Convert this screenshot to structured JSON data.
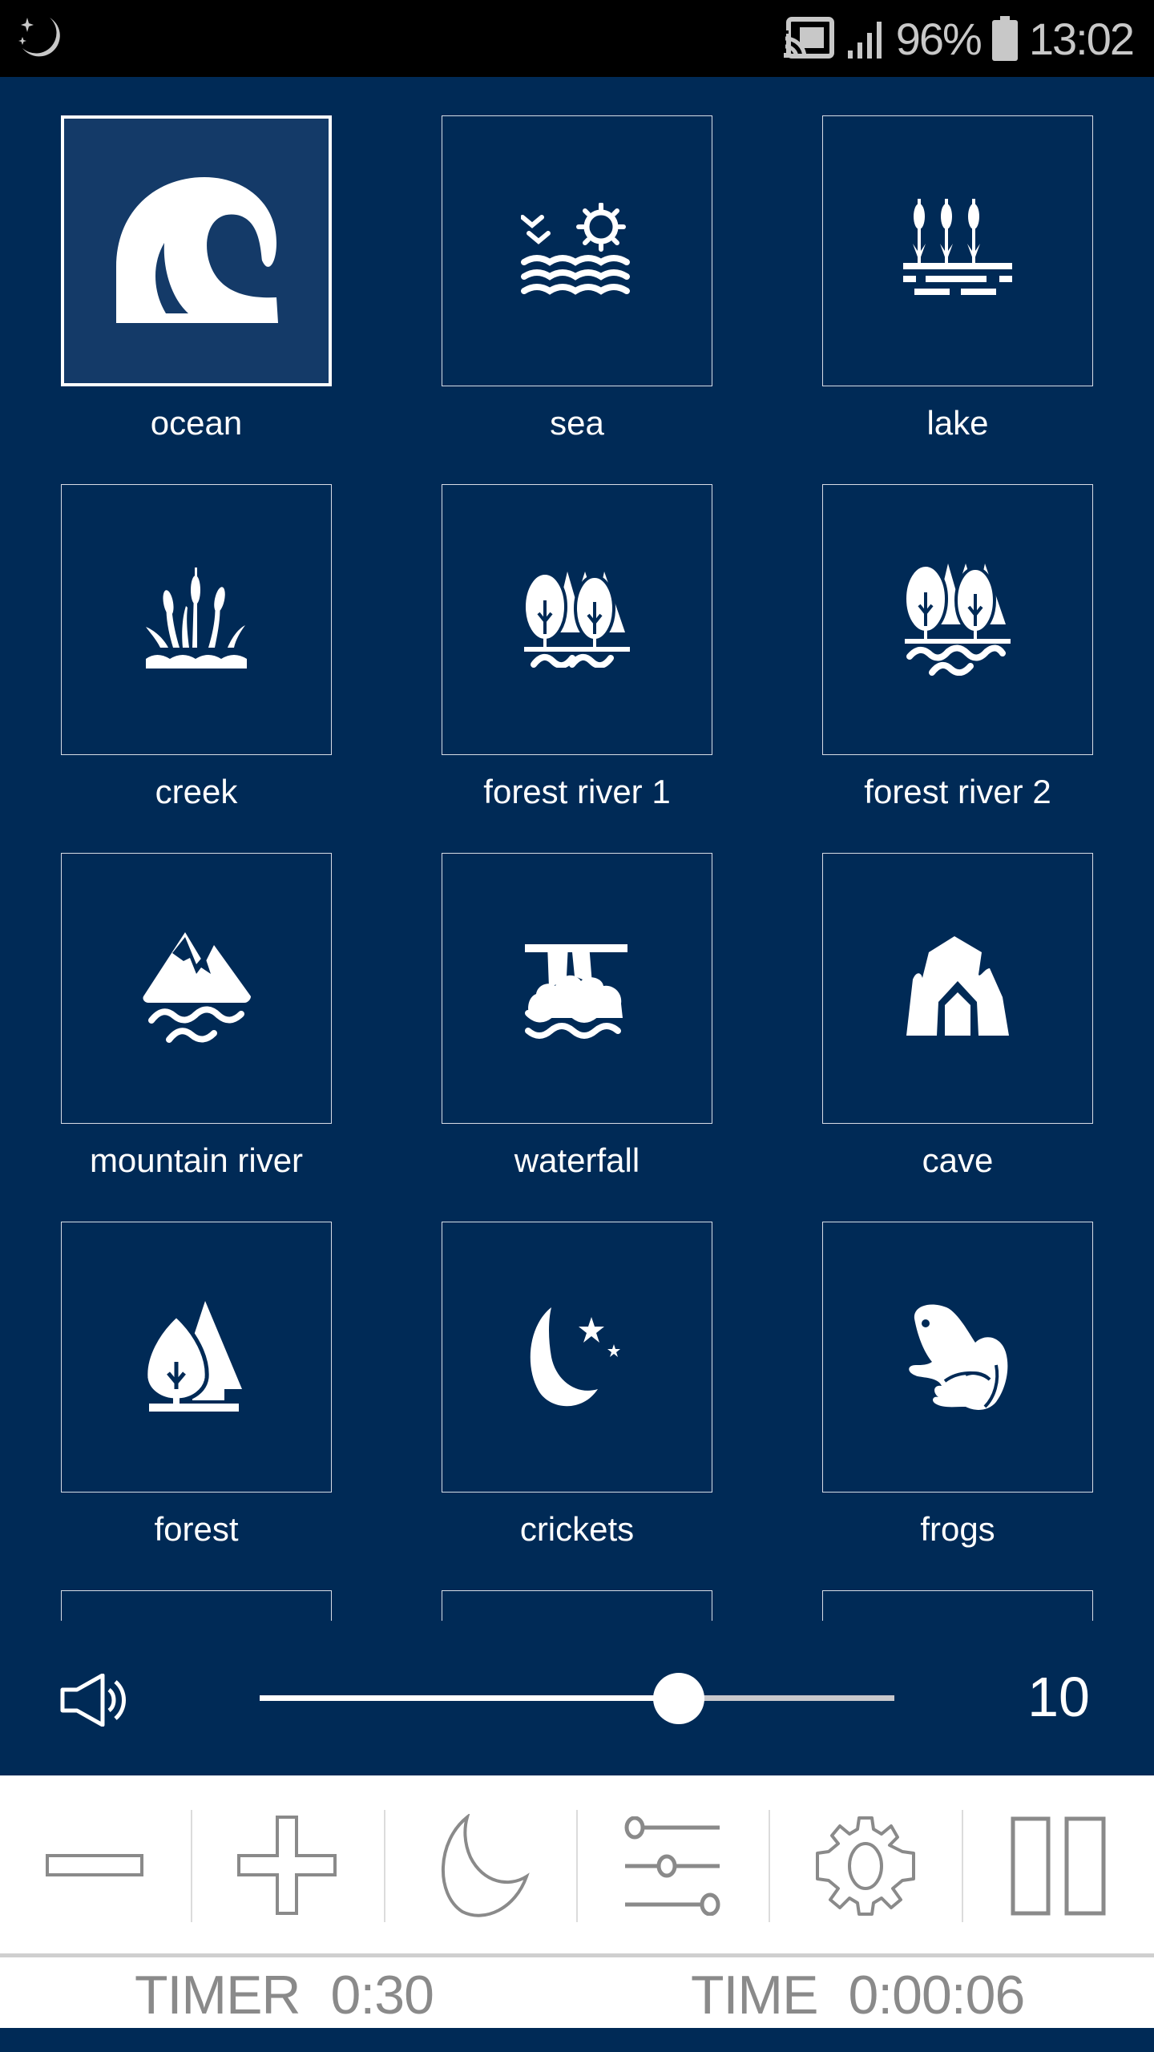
{
  "status_bar": {
    "left_icon": "night-mode-moon-icon",
    "cast_icon": "screen-cast-icon",
    "signal_icon": "signal-strength-icon",
    "battery_percent": "96%",
    "battery_icon": "battery-icon",
    "clock": "13:02"
  },
  "sounds": [
    {
      "label": "ocean",
      "icon": "wave-icon",
      "selected": true
    },
    {
      "label": "sea",
      "icon": "sea-birds-sun-icon",
      "selected": false
    },
    {
      "label": "lake",
      "icon": "cattails-lake-icon",
      "selected": false
    },
    {
      "label": "creek",
      "icon": "reeds-creek-icon",
      "selected": false
    },
    {
      "label": "forest river 1",
      "icon": "trees-river-icon",
      "selected": false
    },
    {
      "label": "forest river 2",
      "icon": "trees-double-river-icon",
      "selected": false
    },
    {
      "label": "mountain river",
      "icon": "mountain-river-icon",
      "selected": false
    },
    {
      "label": "waterfall",
      "icon": "waterfall-icon",
      "selected": false
    },
    {
      "label": "cave",
      "icon": "cave-icon",
      "selected": false
    },
    {
      "label": "forest",
      "icon": "forest-icon",
      "selected": false
    },
    {
      "label": "crickets",
      "icon": "moon-stars-icon",
      "selected": false
    },
    {
      "label": "frogs",
      "icon": "frog-icon",
      "selected": false
    }
  ],
  "volume": {
    "icon": "speaker-icon",
    "level_fraction": 0.66,
    "value": "10"
  },
  "toolbar": {
    "buttons": [
      {
        "name": "decrease-button",
        "icon": "minus-icon"
      },
      {
        "name": "increase-button",
        "icon": "plus-icon"
      },
      {
        "name": "sleep-button",
        "icon": "crescent-moon-icon"
      },
      {
        "name": "mixer-button",
        "icon": "sliders-icon"
      },
      {
        "name": "settings-button",
        "icon": "gear-icon"
      },
      {
        "name": "pause-button",
        "icon": "pause-icon"
      }
    ]
  },
  "timer": {
    "timer_label": "TIMER",
    "timer_value": "0:30",
    "time_label": "TIME",
    "time_value": "0:00:06"
  },
  "colors": {
    "background": "#002a56",
    "selected_tile": "#143a68",
    "toolbar_icon": "#8a8a8a"
  }
}
